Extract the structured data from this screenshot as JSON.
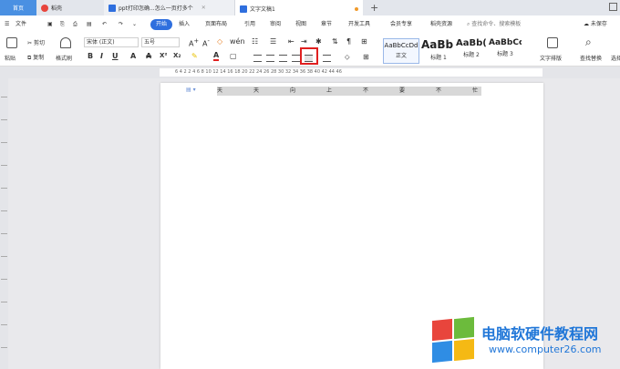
{
  "tabs": {
    "home": "首页",
    "draft": "稻壳",
    "ppt_doc": "ppt打印怎确...怎么一页打多个",
    "current_doc": "文字文稿1"
  },
  "menubar": {
    "file": "文件",
    "items": [
      "开始",
      "插入",
      "页面布局",
      "引用",
      "审阅",
      "视图",
      "章节",
      "开发工具",
      "会员专享",
      "稻壳资源"
    ],
    "search": "查找命令、搜索模板",
    "collab": "未保存"
  },
  "ribbon": {
    "paste": "粘贴",
    "cut": "剪切",
    "copy": "复制",
    "format_painter": "格式刷",
    "font_name": "宋体 (正文)",
    "font_size": "五号",
    "styles": [
      {
        "sample": "AaBbCcDd",
        "name": "正文"
      },
      {
        "sample": "AaBb",
        "name": "标题 1"
      },
      {
        "sample": "AaBb(",
        "name": "标题 2"
      },
      {
        "sample": "AaBbCc",
        "name": "标题 3"
      }
    ],
    "text_layout": "文字排版",
    "find_replace": "查找替换",
    "select": "选择"
  },
  "ruler": {
    "labels": "6  4  2     2  4  6  8  10  12  14  16  18  20  22  24  26  28  30  32  34  36  38  40  42  44  46"
  },
  "document": {
    "chars": [
      "天",
      "天",
      "向",
      "上",
      "不",
      "要",
      "不",
      "忙"
    ]
  },
  "watermark": {
    "title": "电脑软硬件教程网",
    "url": "www.computer26.com"
  },
  "colors": {
    "accent": "#2f6fde",
    "highlight_border": "#e02020",
    "logo_blue": "#2177d8"
  }
}
